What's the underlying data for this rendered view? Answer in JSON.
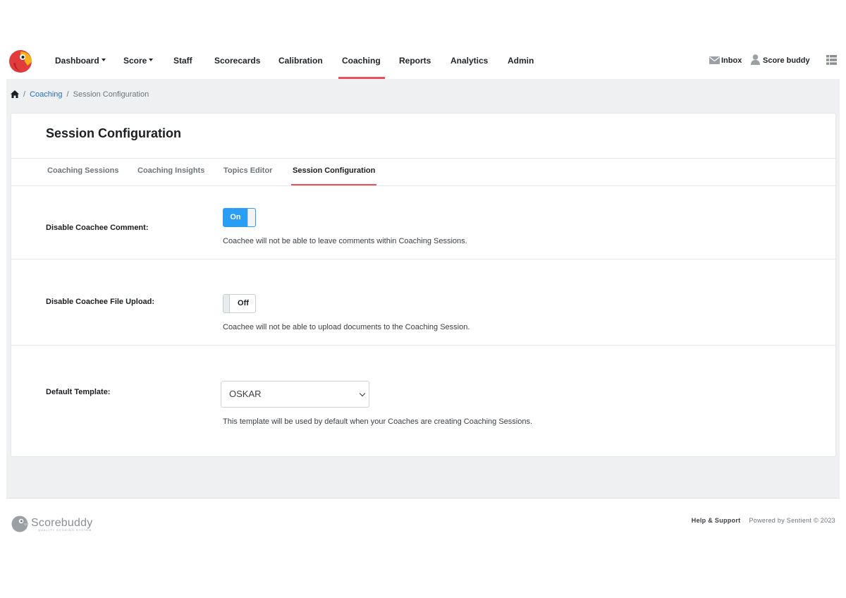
{
  "nav": {
    "items": [
      {
        "label": "Dashboard",
        "dropdown": true
      },
      {
        "label": "Score",
        "dropdown": true
      },
      {
        "label": "Staff"
      },
      {
        "label": "Scorecards"
      },
      {
        "label": "Calibration"
      },
      {
        "label": "Coaching",
        "active": true
      },
      {
        "label": "Reports"
      },
      {
        "label": "Analytics"
      },
      {
        "label": "Admin"
      }
    ],
    "inbox": "Inbox",
    "user": "Score buddy"
  },
  "breadcrumb": {
    "parent": "Coaching",
    "current": "Session Configuration"
  },
  "page": {
    "title": "Session Configuration",
    "tabs": [
      "Coaching Sessions",
      "Coaching Insights",
      "Topics Editor",
      "Session Configuration"
    ],
    "active_tab": "Session Configuration"
  },
  "settings": {
    "comment": {
      "label": "Disable Coachee Comment:",
      "state": "On",
      "help": "Coachee will not be able to leave comments within Coaching Sessions."
    },
    "upload": {
      "label": "Disable Coachee File Upload:",
      "state": "Off",
      "help": "Coachee will not be able to upload documents to the Coaching Session."
    },
    "template": {
      "label": "Default Template:",
      "value": "OSKAR",
      "help": "This template will be used by default when your Coaches are creating Coaching Sessions."
    }
  },
  "footer": {
    "brand": "Scorebuddy",
    "tagline": "QUALITY SCORING SYSTEM",
    "help": "Help & Support",
    "powered": "Powered by Sentient © 2023"
  },
  "colors": {
    "accent": "#e8505b",
    "toggle_on": "#2a9df4",
    "link": "#1f6fbf"
  }
}
